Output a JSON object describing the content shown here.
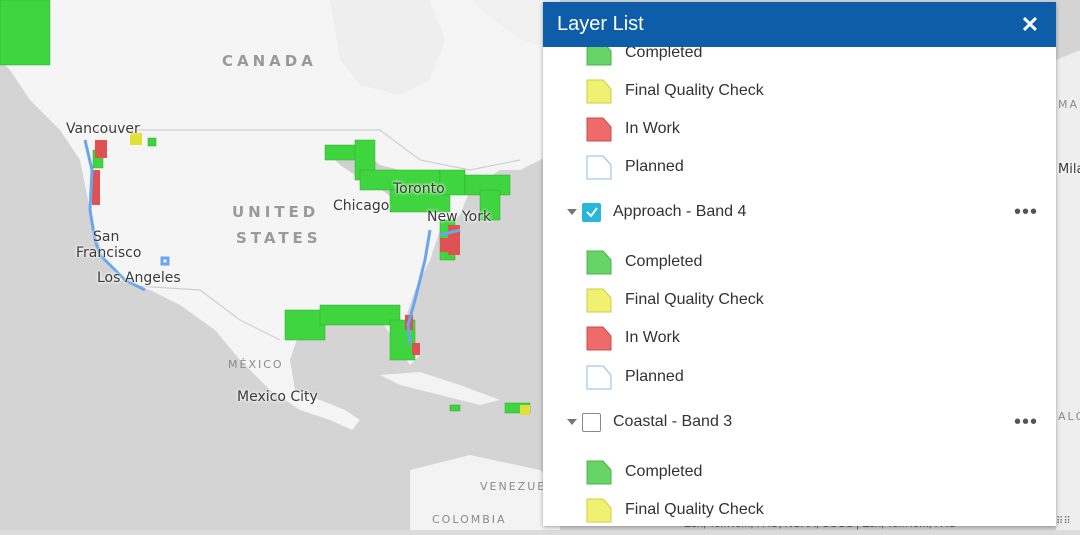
{
  "map": {
    "labels": {
      "canada": "CANADA",
      "united": "UNITED",
      "states": "STATES",
      "mexico": "MÉXICO",
      "vancouver": "Vancouver",
      "toronto": "Toronto",
      "chicago": "Chicago",
      "new_york": "New York",
      "san": "San",
      "francisco": "Francisco",
      "los_angeles": "Los Angeles",
      "mexico_city": "Mexico City",
      "venezuela": "VENEZUE",
      "colombia": "COLOMBIA",
      "edge_1": "MAR",
      "edge_2": "Milan",
      "edge_3": "ALGE"
    },
    "attribution": "Esri, TomTom, FAO, NOAA, USGS | Esri, TomTom, FAO",
    "colors": {
      "completed": "#3fd53f",
      "final_quality_check": "#e0e03a",
      "in_work": "#e05252",
      "planned": "#7fb2ef"
    }
  },
  "layer_list": {
    "title": "Layer List",
    "close_icon": "close-icon",
    "legend_items": {
      "completed": "Completed",
      "final_quality_check": "Final Quality Check",
      "in_work": "In Work",
      "planned": "Planned"
    },
    "layers": [
      {
        "name": "Approach - Band 4",
        "checked": true
      },
      {
        "name": "Coastal - Band 3",
        "checked": false
      }
    ]
  }
}
